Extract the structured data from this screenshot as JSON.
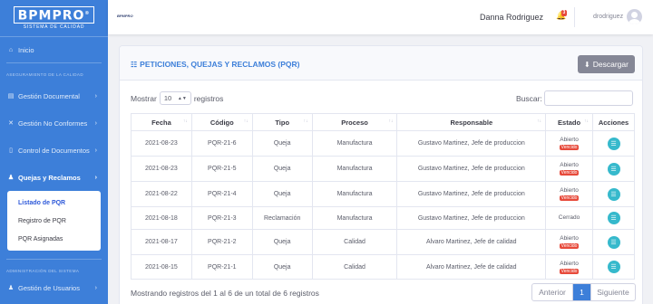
{
  "sidebar": {
    "brand": {
      "name": "BPMPRO",
      "mark": "®",
      "sub": "SISTEMA DE CALIDAD"
    },
    "items": [
      {
        "icon": "⌂",
        "label": "Inicio"
      },
      {
        "icon": "▤",
        "label": "Gestión Documental"
      },
      {
        "icon": "✕",
        "label": "Gestión No Conformes"
      },
      {
        "icon": "▯",
        "label": "Control de Documentos"
      },
      {
        "icon": "♟",
        "label": "Quejas y Reclamos"
      },
      {
        "icon": "♟",
        "label": "Gestión de Usuarios"
      }
    ],
    "heading_quality": "ASEGURAMIENTO DE LA CALIDAD",
    "heading_admin": "ADMINISTRACIÓN DEL SISTEMA",
    "submenu": [
      "Listado de PQR",
      "Registro de PQR",
      "PQR Asignadas"
    ],
    "chevron": "›"
  },
  "topbar": {
    "logo_text": "BPMPRO",
    "user_name": "Danna Rodriguez",
    "bell_icon": "🔔",
    "notifications": "3",
    "username": "drodriguez"
  },
  "card": {
    "title": "PETICIONES, QUEJAS Y RECLAMOS (PQR)",
    "title_icon": "☷",
    "download_icon": "⬇",
    "download_label": "Descargar",
    "show_label": "Mostrar",
    "show_value": "10",
    "records_label": "registros",
    "search_label": "Buscar:",
    "search_value": ""
  },
  "table": {
    "headers": [
      "Fecha",
      "Código",
      "Tipo",
      "Proceso",
      "Responsable",
      "Estado",
      "Acciones"
    ],
    "rows": [
      {
        "fecha": "2021-08-23",
        "codigo": "PQR-21-6",
        "tipo": "Queja",
        "proceso": "Manufactura",
        "responsable": "Gustavo Martinez, Jefe de produccion",
        "estado": "Abierto",
        "badge": "Vencido"
      },
      {
        "fecha": "2021-08-23",
        "codigo": "PQR-21-5",
        "tipo": "Queja",
        "proceso": "Manufactura",
        "responsable": "Gustavo Martinez, Jefe de produccion",
        "estado": "Abierto",
        "badge": "Vencido"
      },
      {
        "fecha": "2021-08-22",
        "codigo": "PQR-21-4",
        "tipo": "Queja",
        "proceso": "Manufactura",
        "responsable": "Gustavo Martinez, Jefe de produccion",
        "estado": "Abierto",
        "badge": "Vencido"
      },
      {
        "fecha": "2021-08-18",
        "codigo": "PQR-21-3",
        "tipo": "Reclamación",
        "proceso": "Manufactura",
        "responsable": "Gustavo Martinez, Jefe de produccion",
        "estado": "Cerrado",
        "badge": ""
      },
      {
        "fecha": "2021-08-17",
        "codigo": "PQR-21-2",
        "tipo": "Queja",
        "proceso": "Calidad",
        "responsable": "Alvaro Martinez, Jefe de calidad",
        "estado": "Abierto",
        "badge": "Vencido"
      },
      {
        "fecha": "2021-08-15",
        "codigo": "PQR-21-1",
        "tipo": "Queja",
        "proceso": "Calidad",
        "responsable": "Alvaro Martinez, Jefe de calidad",
        "estado": "Abierto",
        "badge": "Vencido"
      }
    ],
    "action_icon": "☰"
  },
  "footer": {
    "info": "Mostrando registros del 1 al 6 de un total de 6 registros",
    "prev": "Anterior",
    "page": "1",
    "next": "Siguiente"
  }
}
